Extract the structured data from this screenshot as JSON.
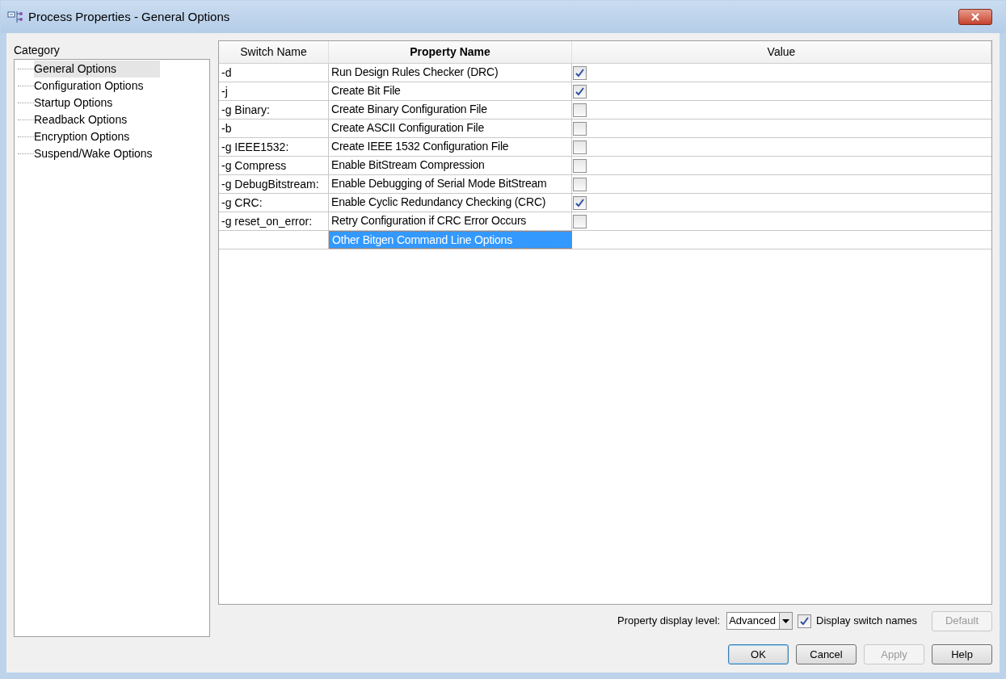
{
  "window": {
    "title": "Process Properties - General Options"
  },
  "category": {
    "label": "Category",
    "items": [
      {
        "label": "General Options",
        "selected": true
      },
      {
        "label": "Configuration Options",
        "selected": false
      },
      {
        "label": "Startup Options",
        "selected": false
      },
      {
        "label": "Readback Options",
        "selected": false
      },
      {
        "label": "Encryption Options",
        "selected": false
      },
      {
        "label": "Suspend/Wake Options",
        "selected": false
      }
    ]
  },
  "table": {
    "columns": [
      "Switch Name",
      "Property Name",
      "Value"
    ],
    "rows": [
      {
        "switch": "-d",
        "property": "Run Design Rules Checker (DRC)",
        "kind": "checkbox",
        "checked": true,
        "selected": false
      },
      {
        "switch": "-j",
        "property": "Create Bit File",
        "kind": "checkbox",
        "checked": true,
        "selected": false
      },
      {
        "switch": "-g Binary:",
        "property": "Create Binary Configuration File",
        "kind": "checkbox",
        "checked": false,
        "selected": false
      },
      {
        "switch": "-b",
        "property": "Create ASCII Configuration File",
        "kind": "checkbox",
        "checked": false,
        "selected": false
      },
      {
        "switch": "-g IEEE1532:",
        "property": "Create IEEE 1532 Configuration File",
        "kind": "checkbox",
        "checked": false,
        "selected": false
      },
      {
        "switch": "-g Compress",
        "property": "Enable BitStream Compression",
        "kind": "checkbox",
        "checked": false,
        "selected": false
      },
      {
        "switch": "-g DebugBitstream:",
        "property": "Enable Debugging of Serial Mode BitStream",
        "kind": "checkbox",
        "checked": false,
        "selected": false
      },
      {
        "switch": "-g CRC:",
        "property": "Enable Cyclic Redundancy Checking (CRC)",
        "kind": "checkbox",
        "checked": true,
        "selected": false
      },
      {
        "switch": "-g reset_on_error:",
        "property": "Retry Configuration if CRC Error Occurs",
        "kind": "checkbox",
        "checked": false,
        "selected": false
      },
      {
        "property": "Other Bitgen Command Line Options",
        "kind": "text",
        "selected": true
      }
    ]
  },
  "display_level": {
    "label": "Property display level:",
    "value": "Advanced"
  },
  "display_switch_names": {
    "label": "Display switch names",
    "checked": true
  },
  "default_button": {
    "label": "Default",
    "disabled": true
  },
  "buttons": [
    {
      "label": "OK",
      "disabled": false,
      "default": true
    },
    {
      "label": "Cancel",
      "disabled": false,
      "default": false
    },
    {
      "label": "Apply",
      "disabled": true,
      "default": false
    },
    {
      "label": "Help",
      "disabled": false,
      "default": false
    }
  ]
}
